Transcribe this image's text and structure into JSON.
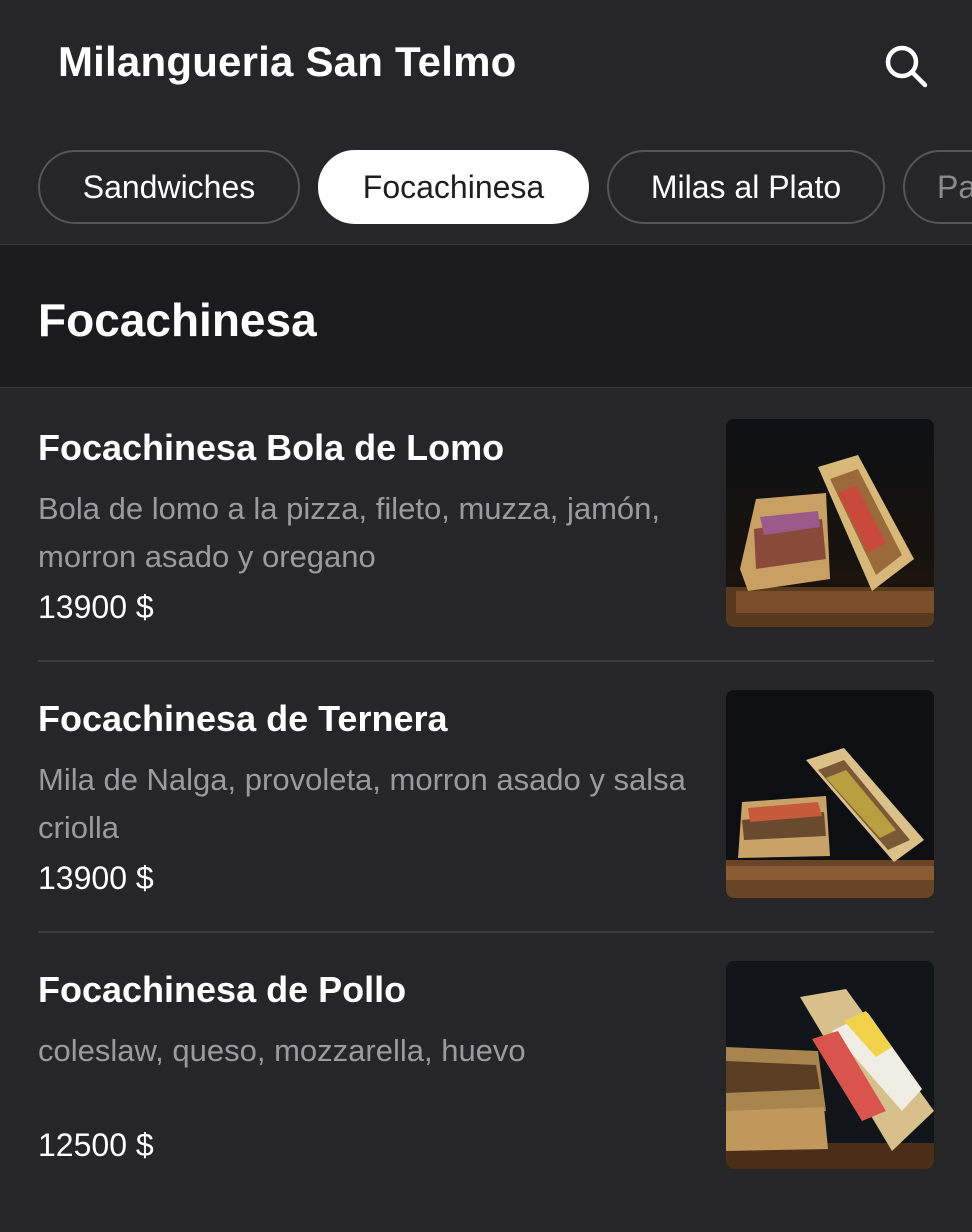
{
  "header": {
    "title": "Milangueria San Telmo",
    "search_icon": "search-icon"
  },
  "tabs": [
    {
      "label": "Sandwiches",
      "active": false
    },
    {
      "label": "Focachinesa",
      "active": true
    },
    {
      "label": "Milas al Plato",
      "active": false
    },
    {
      "label": "Pa",
      "active": false
    }
  ],
  "section": {
    "title": "Focachinesa"
  },
  "items": [
    {
      "name": "Focachinesa Bola de Lomo",
      "description": "Bola de lomo a la pizza, fileto, muzza, jamón, morron asado y oregano",
      "price": "13900 $"
    },
    {
      "name": "Focachinesa de Ternera",
      "description": "Mila de Nalga, provoleta, morron asado y salsa criolla",
      "price": "13900 $"
    },
    {
      "name": "Focachinesa de Pollo",
      "description": "coleslaw, queso, mozzarella, huevo",
      "price": "12500 $"
    }
  ],
  "colors": {
    "background": "#262628",
    "section_band": "#1b1b1d",
    "active_tab_bg": "#ffffff",
    "muted_text": "#9a9aa0"
  }
}
